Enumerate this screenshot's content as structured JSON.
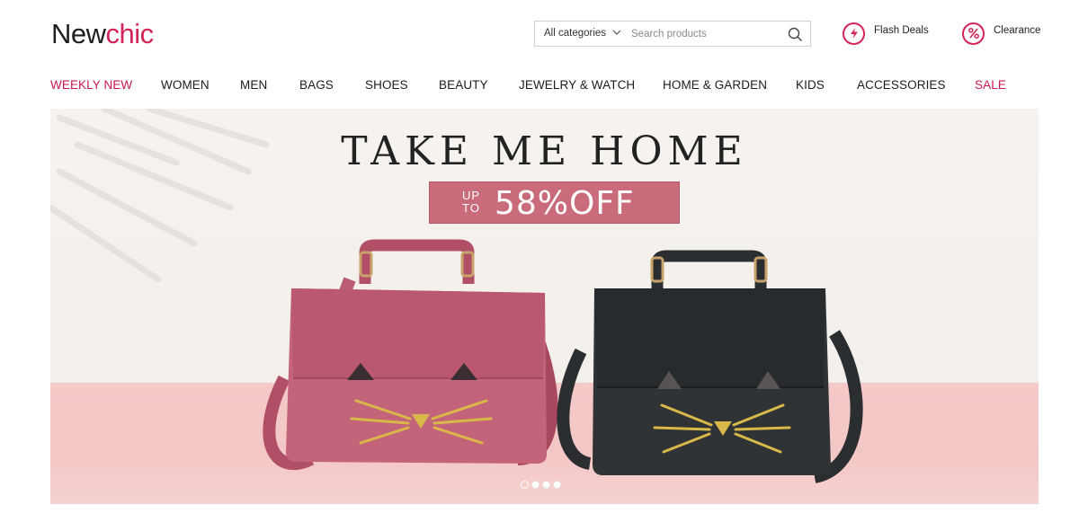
{
  "logo": {
    "part1": "New",
    "part2": "chic"
  },
  "search": {
    "category": "All categories",
    "placeholder": "Search products"
  },
  "header_links": {
    "flash_deals": "Flash Deals",
    "clearance": "Clearance"
  },
  "nav": [
    {
      "label": "WEEKLY NEW",
      "highlight": true
    },
    {
      "label": "WOMEN"
    },
    {
      "label": "MEN"
    },
    {
      "label": "BAGS"
    },
    {
      "label": "SHOES"
    },
    {
      "label": "BEAUTY"
    },
    {
      "label": "JEWELRY & WATCH"
    },
    {
      "label": "HOME & GARDEN"
    },
    {
      "label": "KIDS"
    },
    {
      "label": "ACCESSORIES"
    },
    {
      "label": "SALE",
      "highlight": true
    }
  ],
  "banner": {
    "headline": "TAKE ME HOME",
    "up": "UP",
    "to": "TO",
    "discount": "58%OFF",
    "slides": 4,
    "active_slide": 1
  },
  "colors": {
    "brand": "#d4245a",
    "badge": "#c96b7a",
    "floor": "#f5c9c8"
  }
}
